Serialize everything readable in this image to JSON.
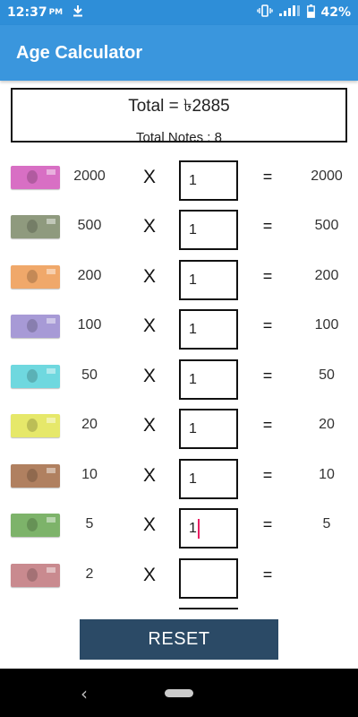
{
  "status_bar": {
    "time": "12:37",
    "ampm": "PM",
    "battery": "42%",
    "download_icon": "download-icon",
    "vibrate_icon": "vibrate-icon",
    "signal_icon": "signal-icon",
    "battery_icon": "battery-icon"
  },
  "app_bar": {
    "title": "Age Calculator"
  },
  "summary": {
    "total_label": "Total =  ৳2885",
    "notes_label": "Total Notes : 8"
  },
  "rows": [
    {
      "denomination": "2000",
      "multiply": "X",
      "quantity": "1",
      "equals": "=",
      "amount": "2000",
      "note_color": "#d86fc4"
    },
    {
      "denomination": "500",
      "multiply": "X",
      "quantity": "1",
      "equals": "=",
      "amount": "500",
      "note_color": "#8f9a7e"
    },
    {
      "denomination": "200",
      "multiply": "X",
      "quantity": "1",
      "equals": "=",
      "amount": "200",
      "note_color": "#f0a86a"
    },
    {
      "denomination": "100",
      "multiply": "X",
      "quantity": "1",
      "equals": "=",
      "amount": "100",
      "note_color": "#a79ad6"
    },
    {
      "denomination": "50",
      "multiply": "X",
      "quantity": "1",
      "equals": "=",
      "amount": "50",
      "note_color": "#6fd8df"
    },
    {
      "denomination": "20",
      "multiply": "X",
      "quantity": "1",
      "equals": "=",
      "amount": "20",
      "note_color": "#e6e86a"
    },
    {
      "denomination": "10",
      "multiply": "X",
      "quantity": "1",
      "equals": "=",
      "amount": "10",
      "note_color": "#b08060"
    },
    {
      "denomination": "5",
      "multiply": "X",
      "quantity": "1",
      "equals": "=",
      "amount": "5",
      "note_color": "#7db36a"
    },
    {
      "denomination": "2",
      "multiply": "X",
      "quantity": "",
      "equals": "=",
      "amount": "",
      "note_color": "#c98a8f"
    }
  ],
  "reset_label": "RESET",
  "nav": {
    "back_icon": "back-icon",
    "home_icon": "home-icon"
  },
  "colors": {
    "status_bar": "#2e8ed8",
    "app_bar": "#3a96dd",
    "reset_button": "#2b4a66",
    "cursor": "#e91e63"
  }
}
